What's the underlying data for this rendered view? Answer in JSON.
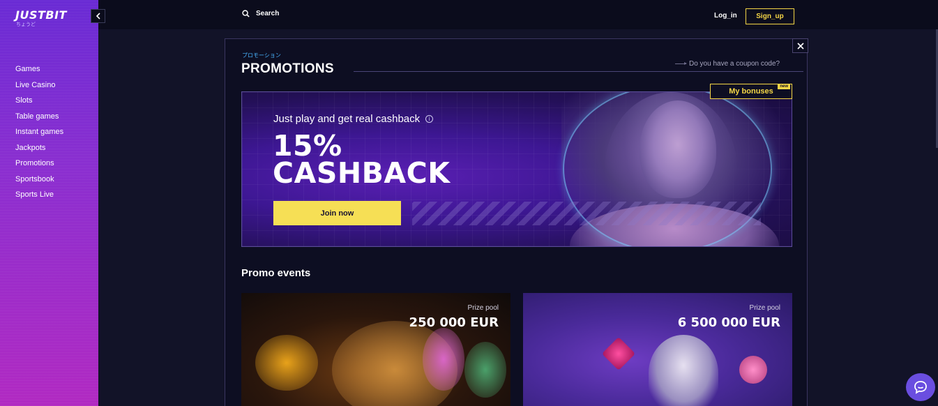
{
  "brand": {
    "logo": "JUSTBIT",
    "logo_sub": "ちょうど"
  },
  "sidebar": {
    "items": [
      {
        "label": "Games"
      },
      {
        "label": "Live Casino"
      },
      {
        "label": "Slots"
      },
      {
        "label": "Table games"
      },
      {
        "label": "Instant games"
      },
      {
        "label": "Jackpots"
      },
      {
        "label": "Promotions"
      },
      {
        "label": "Sportsbook"
      },
      {
        "label": "Sports Live"
      }
    ]
  },
  "topbar": {
    "search_label": "Search",
    "login_label": "Log_in",
    "signup_label": "Sign_up"
  },
  "promotions": {
    "jp_label": "プロモーション",
    "title": "PROMOTIONS",
    "coupon_link": "Do you have a coupon code?",
    "my_bonuses": "My bonuses",
    "new_badge": "new"
  },
  "hero": {
    "subtitle": "Just play and get real cashback",
    "headline_line1": "15%",
    "headline_line2": "CASHBACK",
    "cta": "Join now"
  },
  "events": {
    "title": "Promo events",
    "cards": [
      {
        "prize_label": "Prize pool",
        "amount": "250 000 EUR"
      },
      {
        "prize_label": "Prize pool",
        "amount": "6 500 000 EUR"
      }
    ]
  },
  "colors": {
    "accent": "#f5d646",
    "sidebar_top": "#6a2bd4",
    "sidebar_bottom": "#b12ac2",
    "background": "#0b0c1c",
    "chat": "#6a4ee0"
  }
}
